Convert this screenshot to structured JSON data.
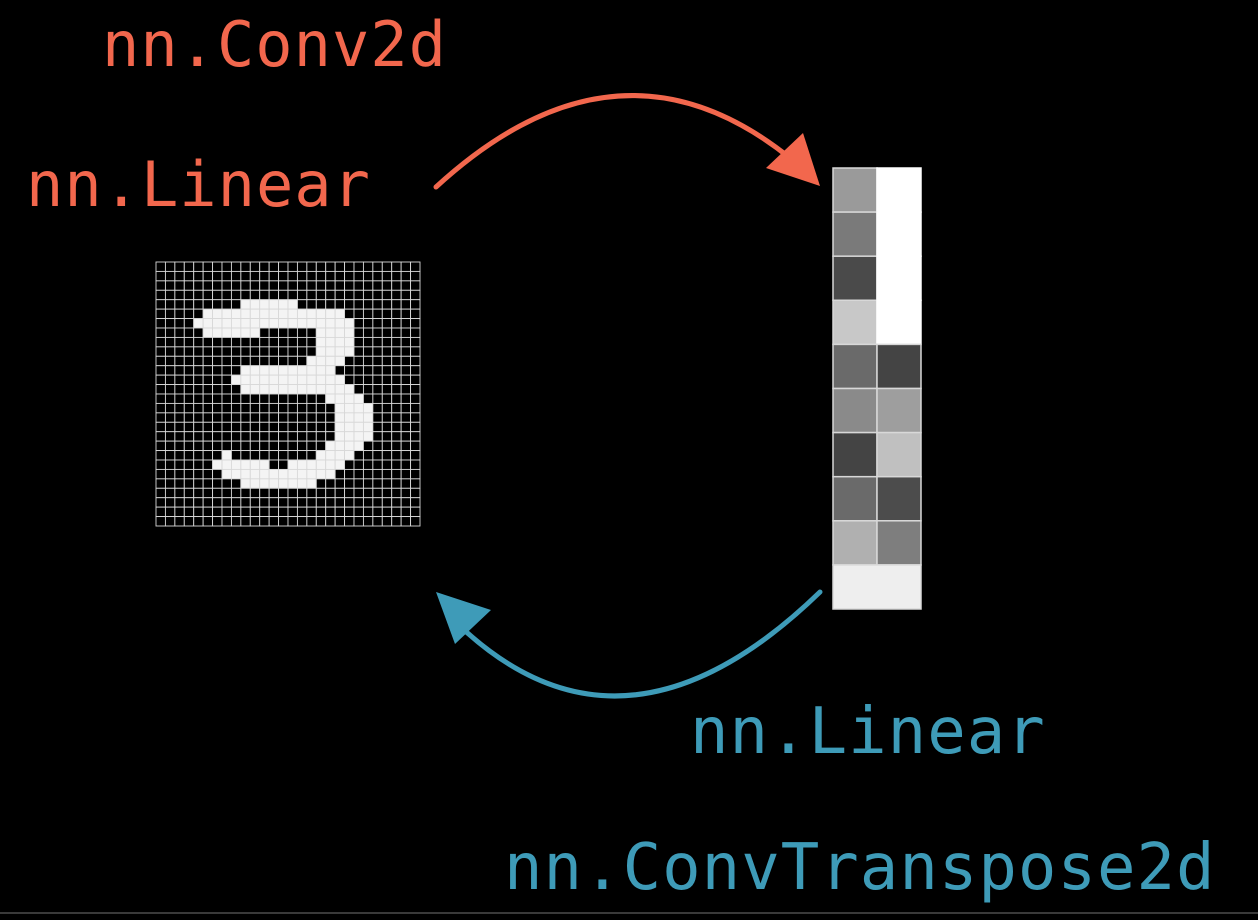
{
  "labels": {
    "encoder_top": "nn.Conv2d",
    "encoder_bottom": "nn.Linear",
    "decoder_top": "nn.Linear",
    "decoder_bottom": "nn.ConvTranspose2d"
  },
  "colors": {
    "encoder": "#f2674d",
    "decoder": "#3e9bb8",
    "background": "#000000"
  },
  "digit_image": {
    "grid_size": 28,
    "rows": [
      "0000000000000000000000000000",
      "0000000000000000000000000000",
      "0000000000000000000000000000",
      "0000000000000000000000000000",
      "0000000001111110000000000000",
      "0000011111111111111100000000",
      "0000111111111111111110000000",
      "0000011111100000011110000000",
      "0000000000000000011110000000",
      "0000000000000000011110000000",
      "0000000000000000111100000000",
      "0000000001111111111000000000",
      "0000000011111111111100000000",
      "0000000001111111111110000000",
      "0000000000000000001111000000",
      "0000000000000000000111100000",
      "0000000000000000000111100000",
      "0000000000000000000111100000",
      "0000000000000000000111100000",
      "0000000000000000001111000000",
      "0000000100000000011110000000",
      "0000001111110011111100000000",
      "0000000111111111111000000000",
      "0000000001111111100000000000",
      "0000000000000000000000000000",
      "0000000000000000000000000000",
      "0000000000000000000000000000",
      "0000000000000000000000000000"
    ]
  },
  "latent_vector": {
    "rows": [
      [
        "#9a9a9a",
        "#ffffff"
      ],
      [
        "#7a7a7a",
        "#ffffff"
      ],
      [
        "#4a4a4a",
        "#ffffff"
      ],
      [
        "#c8c8c8",
        "#ffffff"
      ],
      [
        "#6a6a6a",
        "#444444"
      ],
      [
        "#8a8a8a",
        "#9e9e9e"
      ],
      [
        "#444444",
        "#c0c0c0"
      ],
      [
        "#6a6a6a",
        "#4c4c4c"
      ],
      [
        "#b0b0b0",
        "#7e7e7e"
      ],
      [
        "#eeeeee"
      ]
    ]
  }
}
